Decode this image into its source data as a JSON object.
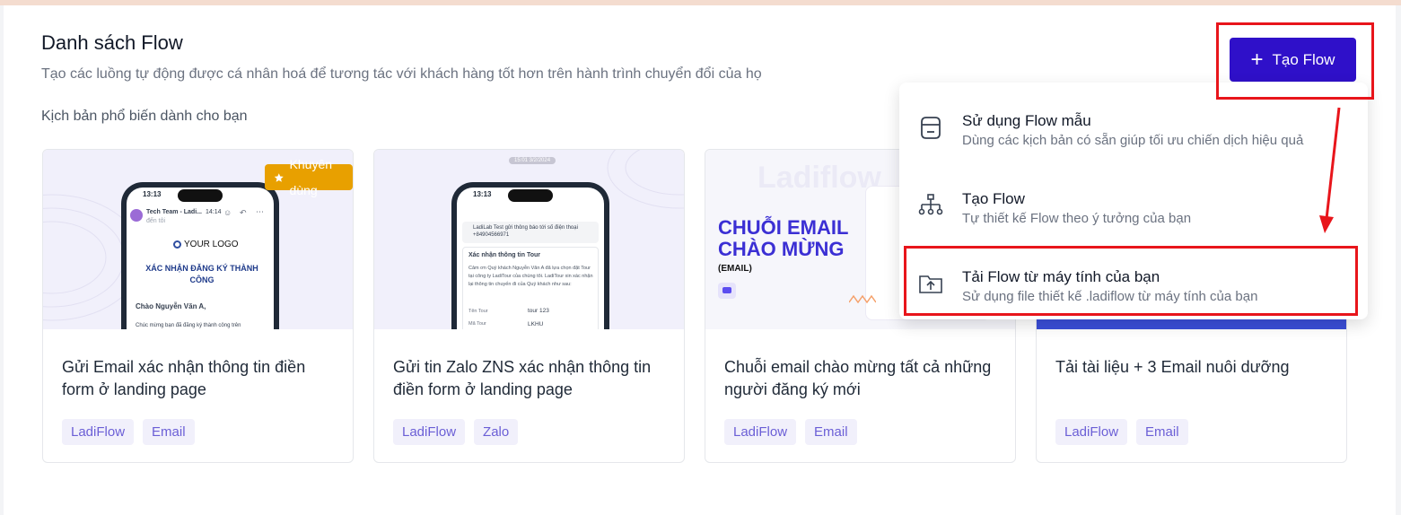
{
  "header": {
    "title": "Danh sách Flow",
    "subtitle": "Tạo các luồng tự động được cá nhân hoá để tương tác với khách hàng tốt hơn trên hành trình chuyển đổi của họ",
    "section_label": "Kịch bản phổ biến dành cho bạn"
  },
  "create_button": {
    "label": "Tạo Flow",
    "icon": "plus-icon"
  },
  "dropdown": {
    "items": [
      {
        "title": "Sử dụng Flow mẫu",
        "subtitle": "Dùng các kịch bản có sẵn giúp tối ưu chiến dịch hiệu quả",
        "icon": "template-box-icon"
      },
      {
        "title": "Tạo Flow",
        "subtitle": "Tự thiết kế Flow theo ý tưởng của bạn",
        "icon": "flow-tree-icon"
      },
      {
        "title": "Tải Flow từ máy tính của bạn",
        "subtitle": "Sử dụng file thiết kế .ladiflow từ máy tính của bạn",
        "icon": "folder-upload-icon"
      }
    ]
  },
  "cards": [
    {
      "title": "Gửi Email xác nhận thông tin điền form ở landing page",
      "tags": [
        "LadiFlow",
        "Email"
      ],
      "badge": "Khuyên dùng",
      "preview": {
        "time": "13:13",
        "sender": "Tech Team - Ladi...",
        "sender_time": "14:14",
        "to": "đến tôi",
        "logo": "YOUR LOGO",
        "heading": "XÁC NHẬN ĐĂNG KÝ THÀNH CÔNG",
        "greeting": "Chào Nguyễn Văn A,",
        "body": "Chúc mừng bạn đã đăng ký thành công trên"
      }
    },
    {
      "title": "Gửi tin Zalo ZNS xác nhận thông tin điền form ở landing page",
      "tags": [
        "LadiFlow",
        "Zalo"
      ],
      "preview": {
        "time": "13:13",
        "chip": "15:01 3/2/2024",
        "notice": "LadiLab Test gửi thông báo tới số điện thoại +84904566971",
        "box_title": "Xác nhận thông tin Tour",
        "box_body": "Cảm ơn Quý khách Nguyễn Văn A đã lựa chọn đặt Tour tại công ty LadiTour của chúng tôi. LadiTour xin xác nhận lại thông tin chuyến đi của Quý khách như sau:",
        "row1_label": "Tên Tour",
        "row1_value": "tour 123",
        "row2_label": "Mã Tour",
        "row2_value": "LKHU"
      }
    },
    {
      "title": "Chuỗi email chào mừng tất cả những người đăng ký mới",
      "tags": [
        "LadiFlow",
        "Email"
      ],
      "preview": {
        "watermark": "Ladiflow",
        "headline_1": "CHUỖI EMAIL",
        "headline_2": "CHÀO MỪNG",
        "tag": "(EMAIL)"
      }
    },
    {
      "title": "Tải tài liệu + 3 Email nuôi dưỡng",
      "tags": [
        "LadiFlow",
        "Email"
      ]
    }
  ],
  "colors": {
    "primary": "#2f10c9",
    "badge": "#e8a000",
    "tag_text": "#6b5fd6",
    "tag_bg": "#f1f0fb",
    "highlight": "#e8151b"
  }
}
